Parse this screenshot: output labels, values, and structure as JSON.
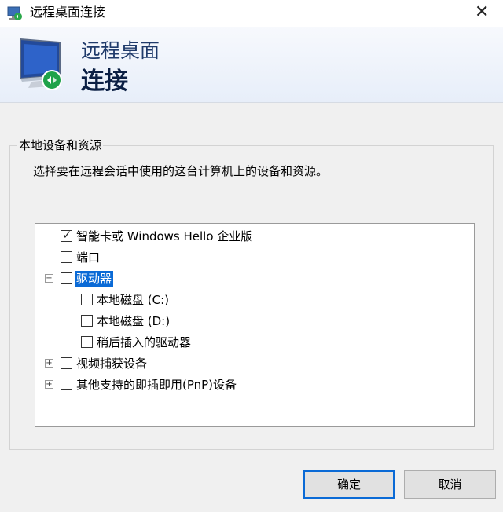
{
  "window": {
    "title": "远程桌面连接",
    "close_glyph": "✕"
  },
  "banner": {
    "line1": "远程桌面",
    "line2": "连接"
  },
  "group": {
    "title": "本地设备和资源",
    "description": "选择要在远程会话中使用的这台计算机上的设备和资源。"
  },
  "tree": {
    "items": [
      {
        "label": "智能卡或 Windows Hello 企业版",
        "checked": true
      },
      {
        "label": "端口",
        "checked": false
      },
      {
        "label": "驱动器",
        "checked": false,
        "expander": "−",
        "selected": true
      },
      {
        "label": "本地磁盘 (C:)",
        "checked": false
      },
      {
        "label": "本地磁盘 (D:)",
        "checked": false
      },
      {
        "label": "稍后插入的驱动器",
        "checked": false
      },
      {
        "label": "视频捕获设备",
        "checked": false,
        "expander": "+"
      },
      {
        "label": "其他支持的即插即用(PnP)设备",
        "checked": false,
        "expander": "+"
      }
    ],
    "check_glyph": "✓"
  },
  "buttons": {
    "ok": "确定",
    "cancel": "取消"
  },
  "colors": {
    "selection": "#0a6ad6",
    "banner_text": "#1f3a6a"
  },
  "icons": {
    "title": "rdp-icon",
    "banner": "monitor-remote-icon"
  }
}
